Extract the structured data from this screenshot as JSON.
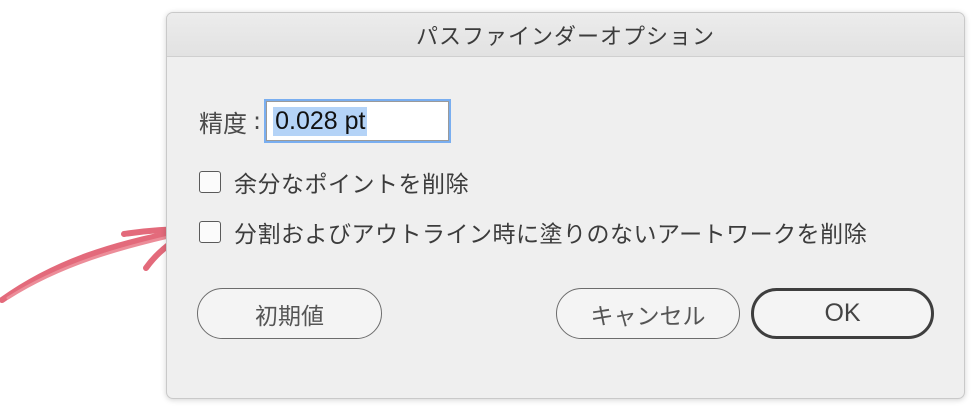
{
  "dialog": {
    "title": "パスファインダーオプション",
    "precision": {
      "label": "精度",
      "colon": ":",
      "value": "0.028 pt"
    },
    "options": [
      {
        "label": "余分なポイントを削除",
        "checked": false
      },
      {
        "label": "分割およびアウトライン時に塗りのないアートワークを削除",
        "checked": false
      }
    ],
    "buttons": {
      "defaults": "初期値",
      "cancel": "キャンセル",
      "ok": "OK"
    }
  },
  "annotation": {
    "arrow_color": "#e36a7b"
  }
}
